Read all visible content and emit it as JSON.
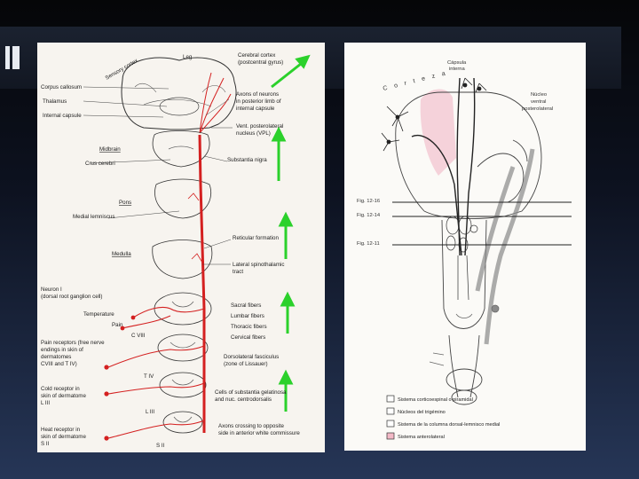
{
  "left_diagram": {
    "labels": {
      "cerebral_cortex": "Cerebral cortex",
      "postcentral": "(postcentral gyrus)",
      "sensory_cortex": "Sensory cortex",
      "leg": "Leg",
      "corpus_callosum": "Corpus callosum",
      "thalamus": "Thalamus",
      "internal_capsule": "Internal capsule",
      "axons_neurons_1": "Axons of neurons",
      "axons_neurons_2": "in posterior limb of",
      "axons_neurons_3": "internal capsule",
      "vent_post_1": "Vent. posterolateral",
      "vent_post_2": "nucleus (VPL)",
      "midbrain": "Midbrain",
      "crus_cerebri": "Crus cerebri",
      "substantia_nigra": "Substantia nigra",
      "pons": "Pons",
      "medial_lemniscus": "Medial lemniscus",
      "reticular_formation": "Reticular formation",
      "medulla": "Medulla",
      "lateral_spino_1": "Lateral spinothalamic",
      "lateral_spino_2": "tract",
      "neuron_1": "Neuron I",
      "neuron_2": "(dorsal root ganglion cell)",
      "temperature": "Temperature",
      "pain": "Pain",
      "c8": "C VIII",
      "sacral": "Sacral fibers",
      "lumbar": "Lumbar fibers",
      "thoracic": "Thoracic fibers",
      "cervical": "Cervical fibers",
      "pain_rec_1": "Pain receptors (free nerve",
      "pain_rec_2": "endings in skin of",
      "pain_rec_3": "dermatomes",
      "pain_rec_4": "CVIII and T IV)",
      "dorso_1": "Dorsolateral fasciculus",
      "dorso_2": "(zone of Lissauer)",
      "t4": "T IV",
      "cold_1": "Cold receptor in",
      "cold_2": "skin of dermatome",
      "cold_3": "L III",
      "l3": "L III",
      "cells_1": "Cells of substantia gelatinosa",
      "cells_2": "and nuc. centrodorsalis",
      "heat_1": "Heat receptor in",
      "heat_2": "skin of dermatome",
      "heat_3": "S II",
      "axons_cross_1": "Axons crossing to opposite",
      "axons_cross_2": "side in anterior white commissure",
      "s2": "S II"
    }
  },
  "right_diagram": {
    "labels": {
      "corteza": "C o r t e z a",
      "capsula_1": "Cápsula",
      "capsula_2": "interna",
      "nucleo_1": "Núcleo",
      "nucleo_2": "ventral",
      "nucleo_3": "posterolateral",
      "fig_1": "Fig. 12-16",
      "fig_2": "Fig. 12-14",
      "fig_3": "Fig. 12-11"
    },
    "legend": [
      "Sistema corticoespinal o piramidal",
      "Núcleos del trigémino",
      "Sistema de la columna dorsal-lemnisco medial",
      "Sistema anterolateral"
    ]
  },
  "colors": {
    "pathway": "#d42020",
    "arrow": "#2bd12b",
    "pink": "#f2b8c6",
    "gray": "#8a8a8a"
  }
}
